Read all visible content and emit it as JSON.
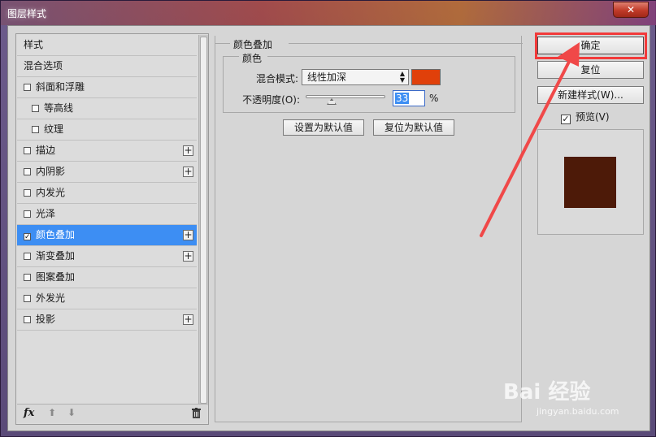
{
  "window": {
    "title": "图层样式",
    "close_glyph": "✕"
  },
  "styles_list": {
    "items": [
      {
        "label": "样式",
        "checkbox": false,
        "checked": false,
        "plus": false,
        "indent": false,
        "selected": false
      },
      {
        "label": "混合选项",
        "checkbox": false,
        "checked": false,
        "plus": false,
        "indent": false,
        "selected": false
      },
      {
        "label": "斜面和浮雕",
        "checkbox": true,
        "checked": false,
        "plus": false,
        "indent": false,
        "selected": false
      },
      {
        "label": "等高线",
        "checkbox": true,
        "checked": false,
        "plus": false,
        "indent": true,
        "selected": false
      },
      {
        "label": "纹理",
        "checkbox": true,
        "checked": false,
        "plus": false,
        "indent": true,
        "selected": false
      },
      {
        "label": "描边",
        "checkbox": true,
        "checked": false,
        "plus": true,
        "indent": false,
        "selected": false
      },
      {
        "label": "内阴影",
        "checkbox": true,
        "checked": false,
        "plus": true,
        "indent": false,
        "selected": false
      },
      {
        "label": "内发光",
        "checkbox": true,
        "checked": false,
        "plus": false,
        "indent": false,
        "selected": false
      },
      {
        "label": "光泽",
        "checkbox": true,
        "checked": false,
        "plus": false,
        "indent": false,
        "selected": false
      },
      {
        "label": "颜色叠加",
        "checkbox": true,
        "checked": true,
        "plus": true,
        "indent": false,
        "selected": true
      },
      {
        "label": "渐变叠加",
        "checkbox": true,
        "checked": false,
        "plus": true,
        "indent": false,
        "selected": false
      },
      {
        "label": "图案叠加",
        "checkbox": true,
        "checked": false,
        "plus": false,
        "indent": false,
        "selected": false
      },
      {
        "label": "外发光",
        "checkbox": true,
        "checked": false,
        "plus": false,
        "indent": false,
        "selected": false
      },
      {
        "label": "投影",
        "checkbox": true,
        "checked": false,
        "plus": true,
        "indent": false,
        "selected": false
      }
    ],
    "footer": {
      "fx_label": "fx",
      "move_up_glyph": "⬆",
      "move_down_glyph": "⬇",
      "delete_icon": "trash-icon"
    }
  },
  "color_overlay": {
    "section_title": "颜色叠加",
    "subsection_title": "颜色",
    "blend_mode_label": "混合模式:",
    "blend_mode_value": "线性加深",
    "overlay_color": "#e0400a",
    "opacity_label": "不透明度(O):",
    "opacity_value": "33",
    "opacity_fraction": 0.33,
    "percent_sign": "%",
    "set_default_label": "设置为默认值",
    "reset_default_label": "复位为默认值"
  },
  "actions": {
    "ok_label": "确定",
    "reset_label": "复位",
    "new_style_label": "新建样式(W)...",
    "preview_label": "预览(V)",
    "preview_checked": true
  },
  "preview": {
    "swatch_color": "#4d1a08"
  },
  "annotation": {
    "highlight_color": "#f23a3a"
  },
  "watermark": {
    "brand": "Bai 经验",
    "url": "jingyan.baidu.com"
  }
}
